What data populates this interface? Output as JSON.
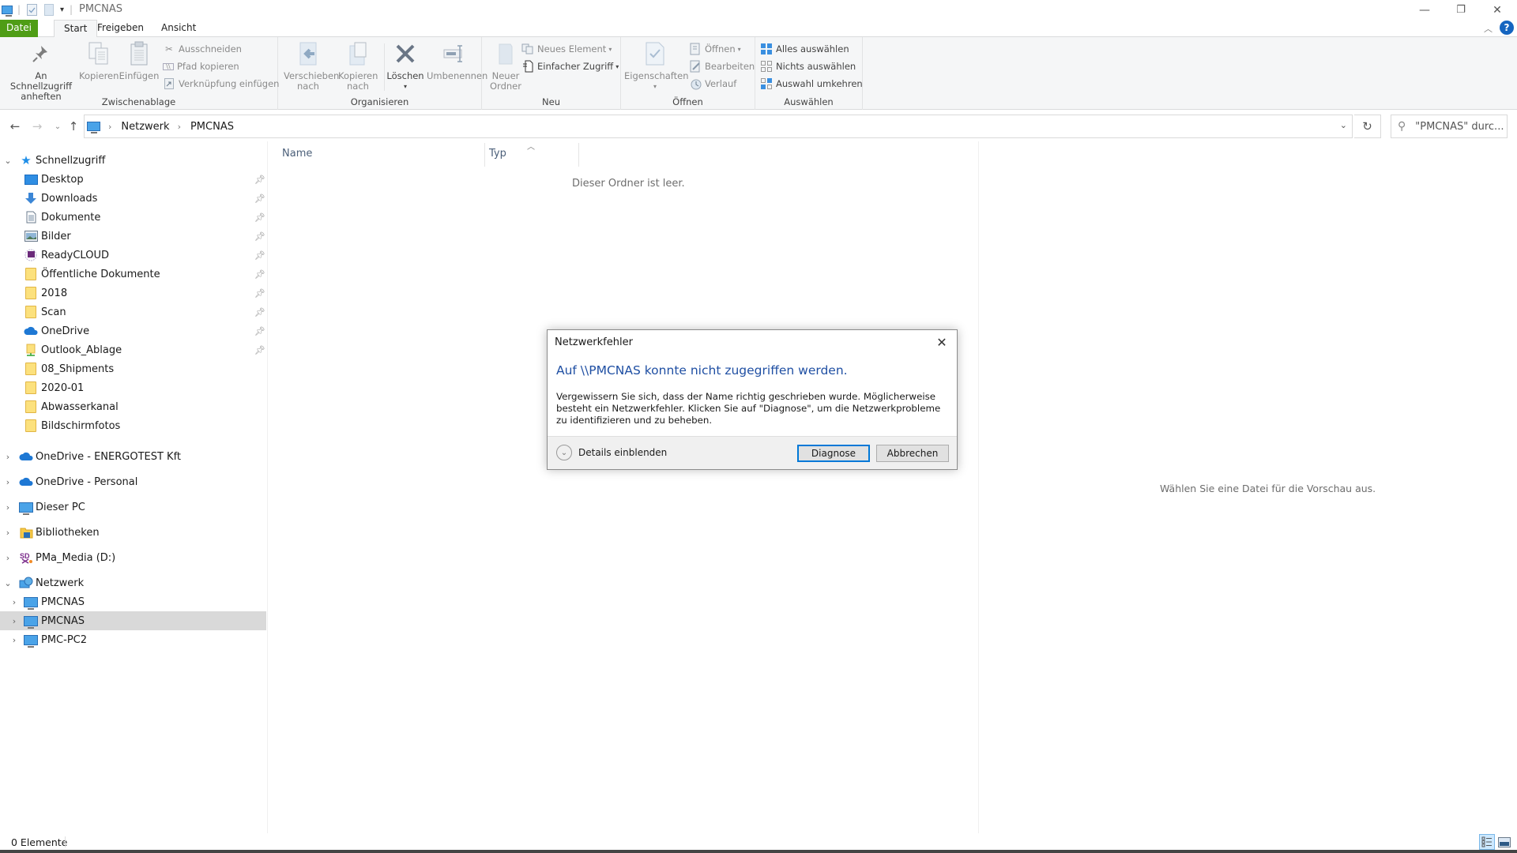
{
  "window": {
    "title": "PMCNAS",
    "controls": {
      "minimize": "—",
      "maximize": "❐",
      "close": "✕"
    },
    "help": "?"
  },
  "tabs": [
    {
      "label": "Datei",
      "active": false
    },
    {
      "label": "Start",
      "active": true
    },
    {
      "label": "Freigeben",
      "active": false
    },
    {
      "label": "Ansicht",
      "active": false
    }
  ],
  "ribbon": {
    "clipboard": {
      "group_label": "Zwischenablage",
      "pin": "An Schnellzugriff anheften",
      "copy": "Kopieren",
      "paste": "Einfügen",
      "cut": "Ausschneiden",
      "copy_path": "Pfad kopieren",
      "paste_shortcut": "Verknüpfung einfügen"
    },
    "organize": {
      "group_label": "Organisieren",
      "move_to": "Verschieben nach",
      "copy_to": "Kopieren nach",
      "delete": "Löschen",
      "rename": "Umbenennen"
    },
    "new": {
      "group_label": "Neu",
      "new_folder": "Neuer Ordner",
      "new_item": "Neues Element",
      "easy_access": "Einfacher Zugriff"
    },
    "open": {
      "group_label": "Öffnen",
      "properties": "Eigenschaften",
      "open": "Öffnen",
      "edit": "Bearbeiten",
      "history": "Verlauf"
    },
    "select": {
      "group_label": "Auswählen",
      "select_all": "Alles auswählen",
      "select_none": "Nichts auswählen",
      "invert": "Auswahl umkehren"
    }
  },
  "navigation": {
    "breadcrumb": [
      "Netzwerk",
      "PMCNAS"
    ],
    "search_placeholder": "\"PMCNAS\" durc..."
  },
  "sidebar": {
    "quick_access": {
      "label": "Schnellzugriff",
      "expanded": true
    },
    "quick_items": [
      {
        "label": "Desktop",
        "icon": "desktop-icon",
        "pinned": true
      },
      {
        "label": "Downloads",
        "icon": "downloads-icon",
        "pinned": true
      },
      {
        "label": "Dokumente",
        "icon": "documents-icon",
        "pinned": true
      },
      {
        "label": "Bilder",
        "icon": "pictures-icon",
        "pinned": true
      },
      {
        "label": "ReadyCLOUD",
        "icon": "readycloud-icon",
        "pinned": true
      },
      {
        "label": "Öffentliche Dokumente",
        "icon": "folder-icon",
        "pinned": true
      },
      {
        "label": "2018",
        "icon": "folder-icon",
        "pinned": true
      },
      {
        "label": "Scan",
        "icon": "folder-icon",
        "pinned": true
      },
      {
        "label": "OneDrive",
        "icon": "onedrive-icon",
        "pinned": true
      },
      {
        "label": "Outlook_Ablage",
        "icon": "network-folder-icon",
        "pinned": true
      },
      {
        "label": "08_Shipments",
        "icon": "folder-icon",
        "pinned": false
      },
      {
        "label": "2020-01",
        "icon": "folder-icon",
        "pinned": false
      },
      {
        "label": "Abwasserkanal",
        "icon": "folder-icon",
        "pinned": false
      },
      {
        "label": "Bildschirmfotos",
        "icon": "folder-icon",
        "pinned": false
      }
    ],
    "roots": [
      {
        "label": "OneDrive - ENERGOTEST Kft",
        "icon": "onedrive-icon"
      },
      {
        "label": "OneDrive - Personal",
        "icon": "onedrive-icon"
      },
      {
        "label": "Dieser PC",
        "icon": "computer-icon"
      },
      {
        "label": "Bibliotheken",
        "icon": "libraries-icon"
      },
      {
        "label": "PMa_Media (D:)",
        "icon": "drive-icon"
      }
    ],
    "network": {
      "label": "Netzwerk",
      "expanded": true
    },
    "network_items": [
      {
        "label": "PMCNAS",
        "selected": false
      },
      {
        "label": "PMCNAS",
        "selected": true
      },
      {
        "label": "PMC-PC2",
        "selected": false
      }
    ]
  },
  "content": {
    "columns": [
      "Name",
      "Typ"
    ],
    "empty_message": "Dieser Ordner ist leer."
  },
  "preview": {
    "message": "Wählen Sie eine Datei für die Vorschau aus."
  },
  "status": {
    "item_count": "0 Elemente"
  },
  "dialog": {
    "title": "Netzwerkfehler",
    "heading": "Auf \\\\PMCNAS konnte nicht zugegriffen werden.",
    "body": "Vergewissern Sie sich, dass der Name richtig geschrieben wurde. Möglicherweise besteht ein Netzwerkfehler. Klicken Sie auf \"Diagnose\", um die Netzwerkprobleme zu identifizieren und zu beheben.",
    "details_label": "Details einblenden",
    "diagnose_label": "Diagnose",
    "cancel_label": "Abbrechen"
  },
  "colors": {
    "file_tab": "#4f9d16",
    "dialog_heading": "#1f4fa3",
    "selection": "#d9d9d9",
    "default_button_border": "#0078d7"
  }
}
